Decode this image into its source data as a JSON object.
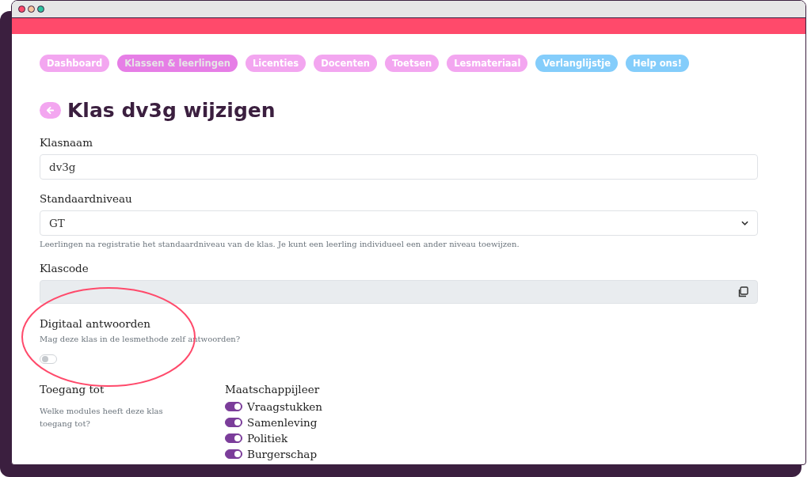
{
  "nav": [
    {
      "label": "Dashboard",
      "selected": false,
      "color": "#f3a6f0"
    },
    {
      "label": "Klassen & leerlingen",
      "selected": true,
      "color": "#f3a6f0"
    },
    {
      "label": "Licenties",
      "selected": false,
      "color": "#f3a6f0"
    },
    {
      "label": "Docenten",
      "selected": false,
      "color": "#f3a6f0"
    },
    {
      "label": "Toetsen",
      "selected": false,
      "color": "#f3a6f0"
    },
    {
      "label": "Lesmateriaal",
      "selected": false,
      "color": "#f3a6f0"
    },
    {
      "label": "Verlanglijstje",
      "selected": false,
      "color": "#84cdfb"
    },
    {
      "label": "Help ons!",
      "selected": false,
      "color": "#84cdfb"
    }
  ],
  "title": "Klas dv3g wijzigen",
  "class_name": {
    "label": "Klasnaam",
    "value": "dv3g"
  },
  "default_level": {
    "label": "Standaardniveau",
    "value": "GT",
    "help": "Leerlingen na registratie het standaardniveau van de klas. Je kunt een leerling individueel een ander niveau toewijzen."
  },
  "class_code": {
    "label": "Klascode"
  },
  "digital_answering": {
    "label": "Digitaal antwoorden",
    "help": "Mag deze klas in de lesmethode zelf antwoorden?",
    "on": false
  },
  "access": {
    "label": "Toegang tot",
    "help": "Welke modules heeft deze klas toegang tot?"
  },
  "modules": {
    "title": "Maatschappijleer",
    "items": [
      {
        "label": "Vraagstukken",
        "on": true
      },
      {
        "label": "Samenleving",
        "on": true
      },
      {
        "label": "Politiek",
        "on": true
      },
      {
        "label": "Burgerschap",
        "on": true
      }
    ]
  }
}
